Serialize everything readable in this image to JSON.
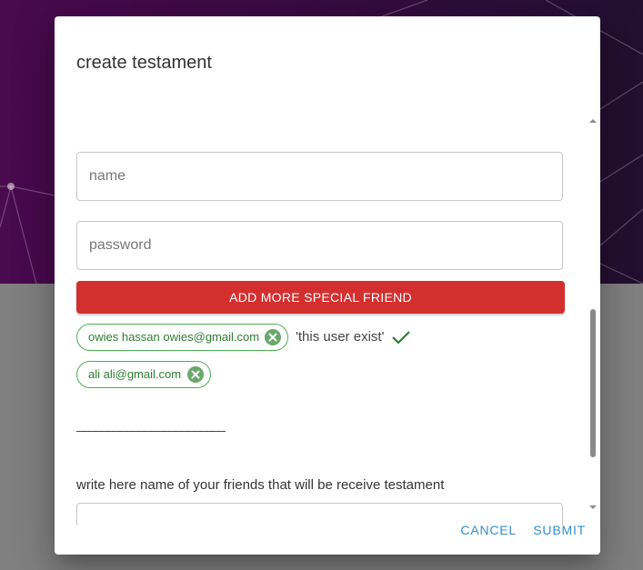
{
  "dialog": {
    "title": "create testament"
  },
  "form": {
    "name_placeholder": "name",
    "password_placeholder": "password",
    "add_button_label": "ADD MORE SPECIAL FRIEND",
    "chips": [
      {
        "label": "owies hassan owies@gmail.com"
      },
      {
        "label": "ali ali@gmail.com"
      }
    ],
    "user_exist_text": "'this user exist'",
    "divider_text": "________________________",
    "friends_hint": "write here name of your friends that will be receive testament"
  },
  "actions": {
    "cancel_label": "CANCEL",
    "submit_label": "SUBMIT"
  },
  "colors": {
    "add_button": "#d32f2f",
    "chip_border": "#4caf50",
    "action_text": "#2f8fd0",
    "background_top": "#3a0b44",
    "overlay": "#808080"
  },
  "icons": {
    "chip_remove": "cancel-icon",
    "check": "check-icon",
    "scroll_up": "chevron-up-icon",
    "scroll_down": "chevron-down-icon"
  }
}
